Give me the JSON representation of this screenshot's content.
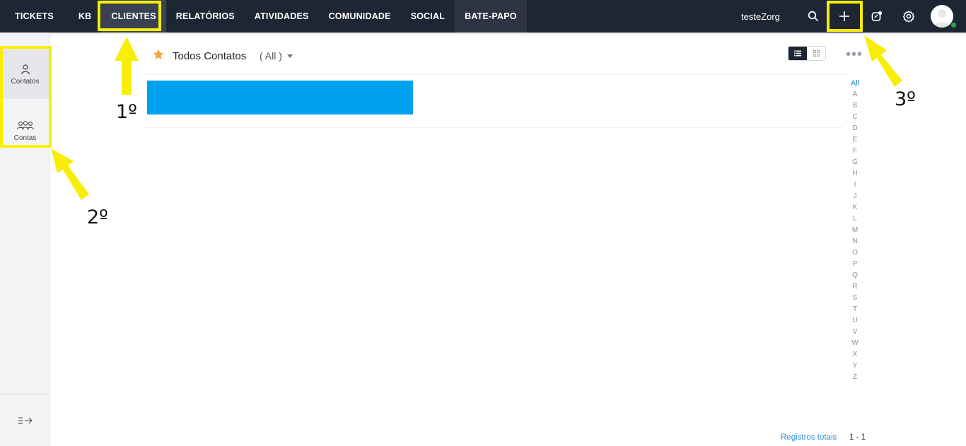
{
  "topbar": {
    "nav": [
      "TICKETS",
      "KB",
      "CLIENTES",
      "RELATÓRIOS",
      "ATIVIDADES",
      "COMUNIDADE",
      "SOCIAL",
      "BATE-PAPO"
    ],
    "user_name": "testeZorg"
  },
  "sidebar": {
    "items": [
      {
        "label": "Contatos",
        "icon": "person-icon"
      },
      {
        "label": "Contas",
        "icon": "group-icon"
      }
    ],
    "collapse_icon": "expand-sidebar-icon"
  },
  "view": {
    "title": "Todos Contatos",
    "filter": "( All )"
  },
  "alphabet": [
    "All",
    "A",
    "B",
    "C",
    "D",
    "E",
    "F",
    "G",
    "H",
    "I",
    "J",
    "K",
    "L",
    "M",
    "N",
    "O",
    "P",
    "Q",
    "R",
    "S",
    "T",
    "U",
    "V",
    "W",
    "X",
    "Y",
    "Z"
  ],
  "footer": {
    "label": "Registros totais",
    "count": "1 - 1"
  },
  "annotations": {
    "step1": "1º",
    "step2": "2º",
    "step3": "3º"
  },
  "colors": {
    "topbar": "#1f2633",
    "highlight": "#f7ee04",
    "redaction": "#00a2ed",
    "link": "#2f8fd6"
  }
}
